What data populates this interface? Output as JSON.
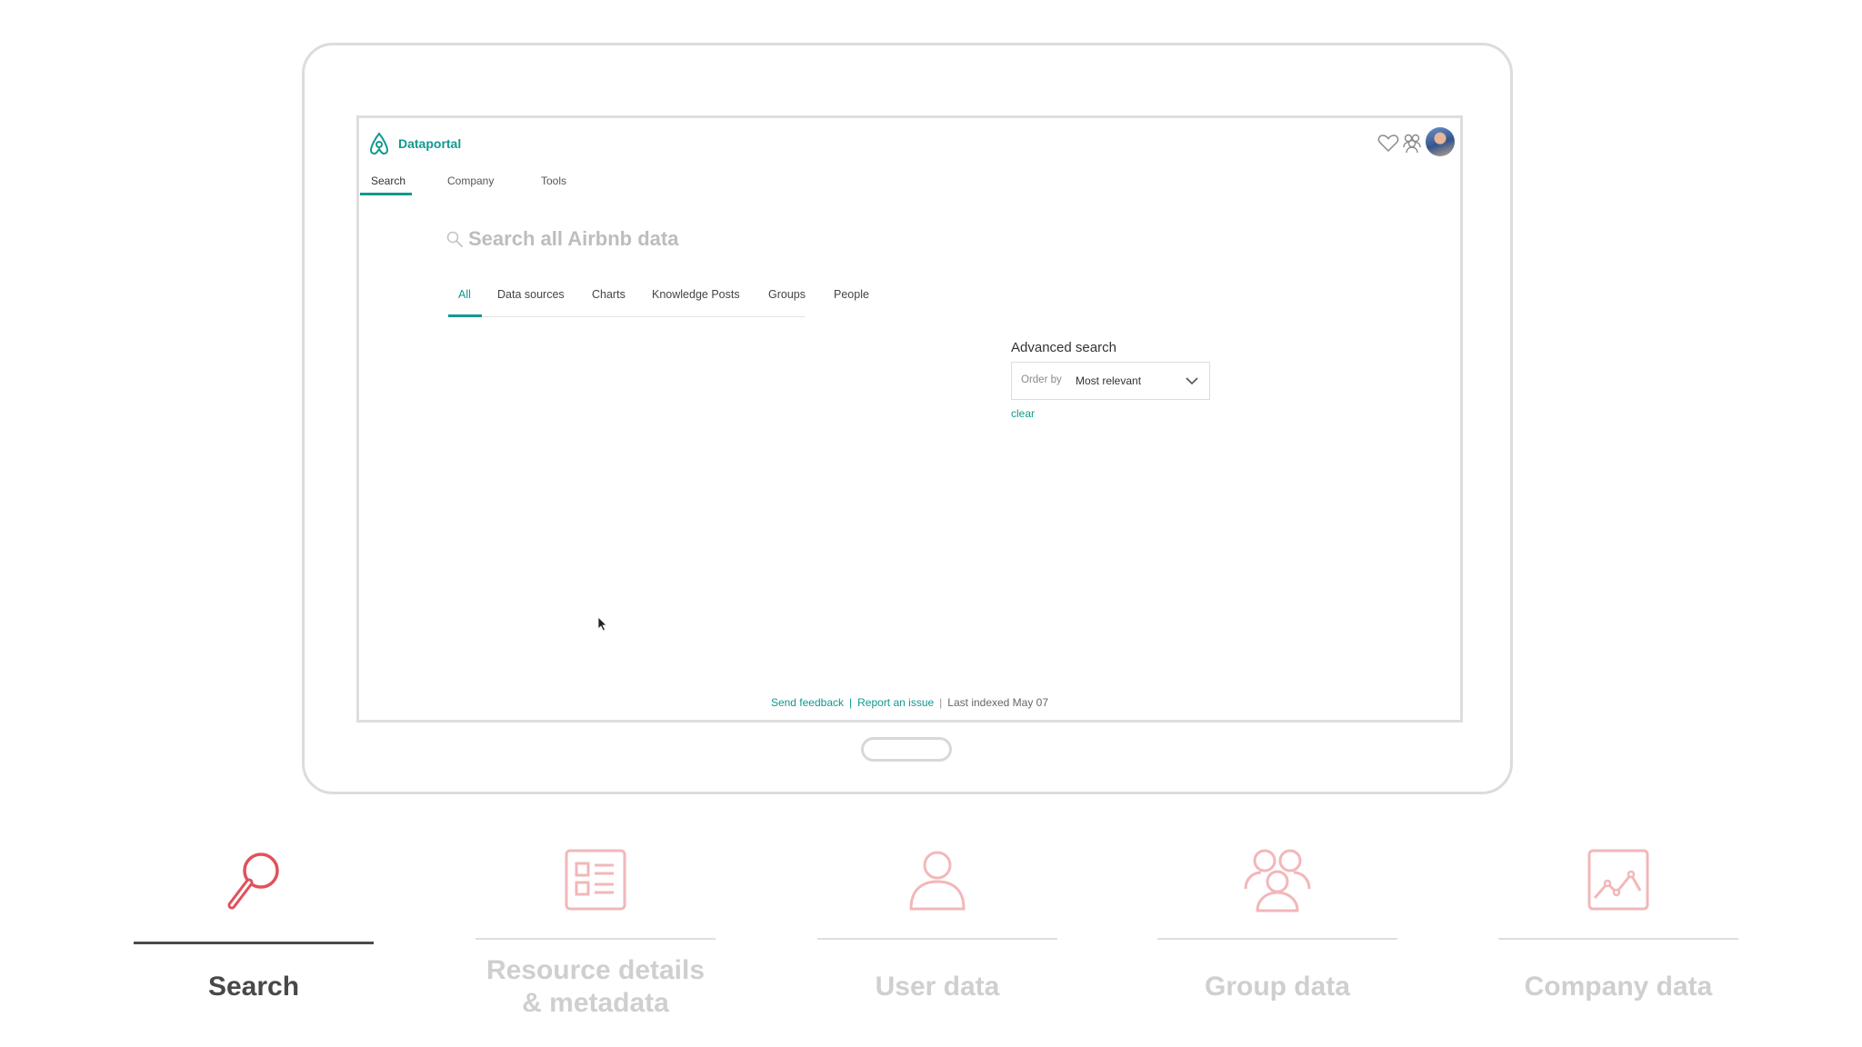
{
  "app": {
    "brand": "Dataportal"
  },
  "header": {
    "icons": [
      "heart-icon",
      "group-icon",
      "avatar"
    ]
  },
  "main_tabs": [
    {
      "label": "Search",
      "active": true
    },
    {
      "label": "Company",
      "active": false
    },
    {
      "label": "Tools",
      "active": false
    }
  ],
  "search": {
    "placeholder": "Search all Airbnb data"
  },
  "sub_tabs": [
    {
      "label": "All",
      "active": true
    },
    {
      "label": "Data sources",
      "active": false
    },
    {
      "label": "Charts",
      "active": false
    },
    {
      "label": "Knowledge Posts",
      "active": false
    },
    {
      "label": "Groups",
      "active": false
    },
    {
      "label": "People",
      "active": false
    }
  ],
  "advanced": {
    "title": "Advanced search",
    "order_by_label": "Order by",
    "order_by_value": "Most relevant",
    "clear_label": "clear"
  },
  "footer": {
    "send_feedback": "Send feedback",
    "report_issue": "Report an issue",
    "sep": "|",
    "last_indexed": "Last indexed May 07"
  },
  "features": [
    {
      "label": "Search",
      "icon": "magnifier-icon",
      "active": true
    },
    {
      "label": "Resource details & metadata",
      "icon": "details-list-icon",
      "active": false
    },
    {
      "label": "User data",
      "icon": "user-icon",
      "active": false
    },
    {
      "label": "Group data",
      "icon": "group-icon",
      "active": false
    },
    {
      "label": "Company data",
      "icon": "chart-icon",
      "active": false
    }
  ],
  "colors": {
    "accent": "#11998e",
    "feature_active_icon": "#e0525c",
    "feature_inactive_icon": "#f2b7ba"
  }
}
